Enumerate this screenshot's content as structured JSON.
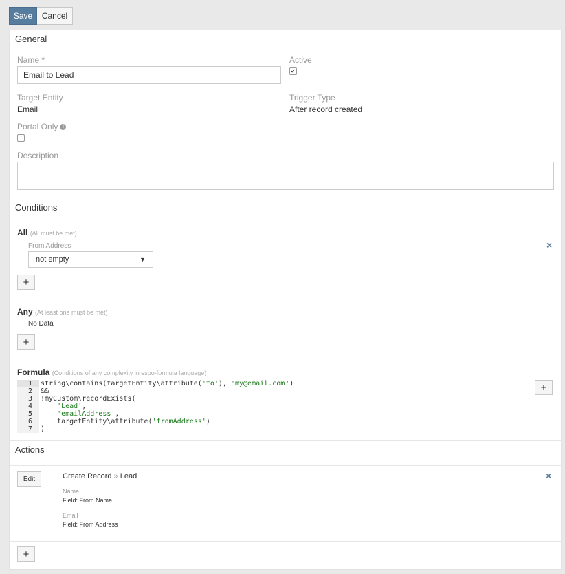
{
  "toolbar": {
    "save_label": "Save",
    "cancel_label": "Cancel"
  },
  "general": {
    "title": "General",
    "name_label": "Name *",
    "name_value": "Email to Lead",
    "active_label": "Active",
    "active_checked": true,
    "target_entity_label": "Target Entity",
    "target_entity_value": "Email",
    "trigger_type_label": "Trigger Type",
    "trigger_type_value": "After record created",
    "portal_only_label": "Portal Only",
    "portal_only_checked": false,
    "description_label": "Description",
    "description_value": ""
  },
  "conditions": {
    "title": "Conditions",
    "all": {
      "title": "All",
      "hint": "(All must be met)",
      "field_label": "From Address",
      "selected_option": "not empty"
    },
    "any": {
      "title": "Any",
      "hint": "(At least one must be met)",
      "no_data": "No Data"
    },
    "formula": {
      "title": "Formula",
      "hint": "(Conditions of any complexity in espo-formula language)",
      "line_numbers": [
        "1",
        "2",
        "3",
        "4",
        "5",
        "6",
        "7"
      ]
    }
  },
  "actions": {
    "title": "Actions",
    "edit_label": "Edit",
    "action_title": "Create Record",
    "action_separator": "»",
    "action_entity": "Lead",
    "field1_label": "Name",
    "field1_value": "Field: From Name",
    "field2_label": "Email",
    "field2_value": "Field: From Address"
  },
  "icons": {
    "add": "+",
    "remove": "×",
    "info": "i",
    "caret": "▼",
    "check": "✔"
  }
}
